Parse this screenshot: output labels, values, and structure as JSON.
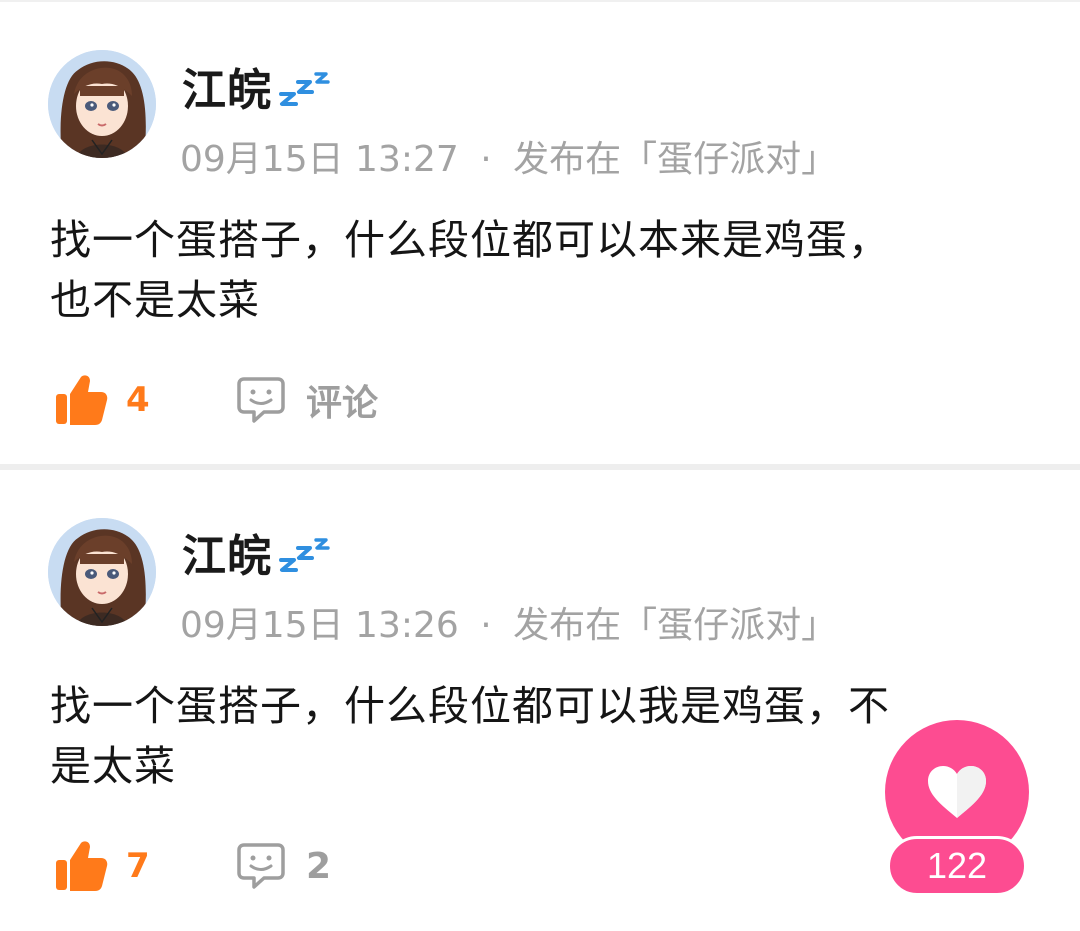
{
  "colors": {
    "like_orange": "#ff7a1a",
    "meta_gray": "#a3a3a3",
    "fab_pink": "#fd4c91",
    "zzz_blue": "#2f8fe0"
  },
  "posts": [
    {
      "author": "江皖",
      "author_badge": "zzz-icon",
      "timestamp": "09月15日 13:27",
      "separator": "·",
      "published_in": "发布在「蛋仔派对」",
      "text_lines": [
        "找一个蛋搭子，什么段位都可以本来是鸡蛋，",
        "也不是太菜"
      ],
      "likes": "4",
      "comment_label": "评论"
    },
    {
      "author": "江皖",
      "author_badge": "zzz-icon",
      "timestamp": "09月15日 13:26",
      "separator": "·",
      "published_in": "发布在「蛋仔派对」",
      "text_lines": [
        "找一个蛋搭子，什么段位都可以我是鸡蛋，不",
        "是太菜"
      ],
      "likes": "7",
      "comment_label": "2"
    }
  ],
  "floating_like": {
    "icon": "heart-icon",
    "count": "122"
  }
}
